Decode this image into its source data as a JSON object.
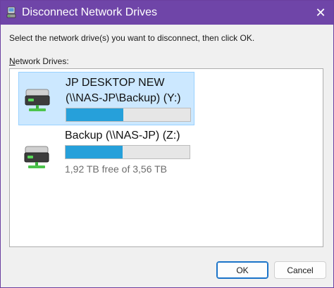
{
  "window": {
    "title": "Disconnect Network Drives",
    "close_glyph": "✕",
    "accent_color": "#6f45a8"
  },
  "instruction": "Select the network drive(s) you want to disconnect, then click OK.",
  "list": {
    "label_accel": "N",
    "label_rest": "etwork Drives:",
    "drives": [
      {
        "name_line1": "JP DESKTOP NEW",
        "name_line2": "(\\\\NAS-JP\\Backup) (Y:)",
        "used_fraction": 0.46,
        "selected": true,
        "icon": "network-drive-icon"
      },
      {
        "name_line1": "Backup (\\\\NAS-JP) (Z:)",
        "free_text": "1,92 TB free of 3,56 TB",
        "used_fraction": 0.46,
        "selected": false,
        "icon": "network-drive-icon"
      }
    ]
  },
  "buttons": {
    "ok": "OK",
    "cancel": "Cancel"
  }
}
